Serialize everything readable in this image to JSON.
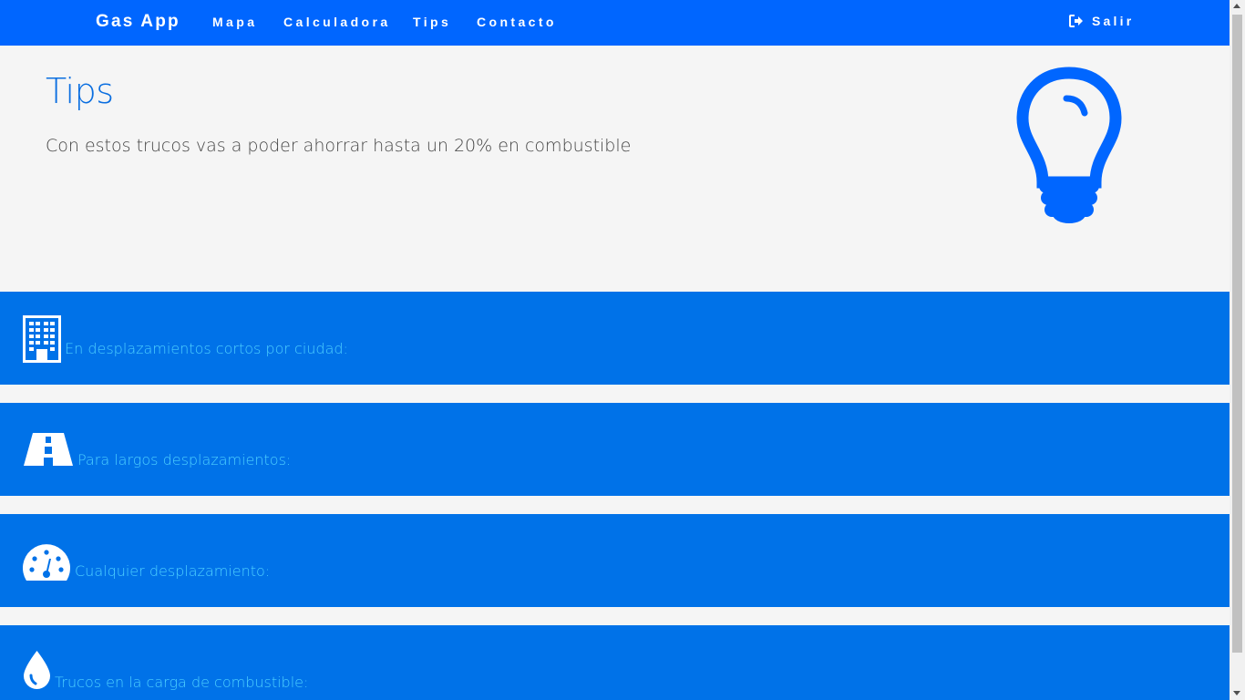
{
  "navbar": {
    "brand": "Gas App",
    "items": [
      {
        "label": "Mapa"
      },
      {
        "label": "Calculadora"
      },
      {
        "label": "Tips"
      },
      {
        "label": "Contacto"
      }
    ],
    "logout_label": "Salir",
    "logout_icon": "sign-out-icon"
  },
  "hero": {
    "title": "Tips",
    "subtitle": "Con estos trucos vas a poder ahorrar hasta un 20% en combustible",
    "icon": "lightbulb-icon"
  },
  "tips": [
    {
      "icon": "building-icon",
      "label": "En desplazamientos cortos por ciudad:"
    },
    {
      "icon": "road-icon",
      "label": "Para largos desplazamientos:"
    },
    {
      "icon": "speedometer-icon",
      "label": "Cualquier desplazamiento:"
    },
    {
      "icon": "fuel-drop-icon",
      "label": "Trucos en la carga de combustible:"
    }
  ],
  "colors": {
    "navbar": "#0066ff",
    "section": "#0072e8",
    "section_text": "#4dd0ff",
    "title": "#0a6ee0",
    "background": "#f5f5f5"
  }
}
